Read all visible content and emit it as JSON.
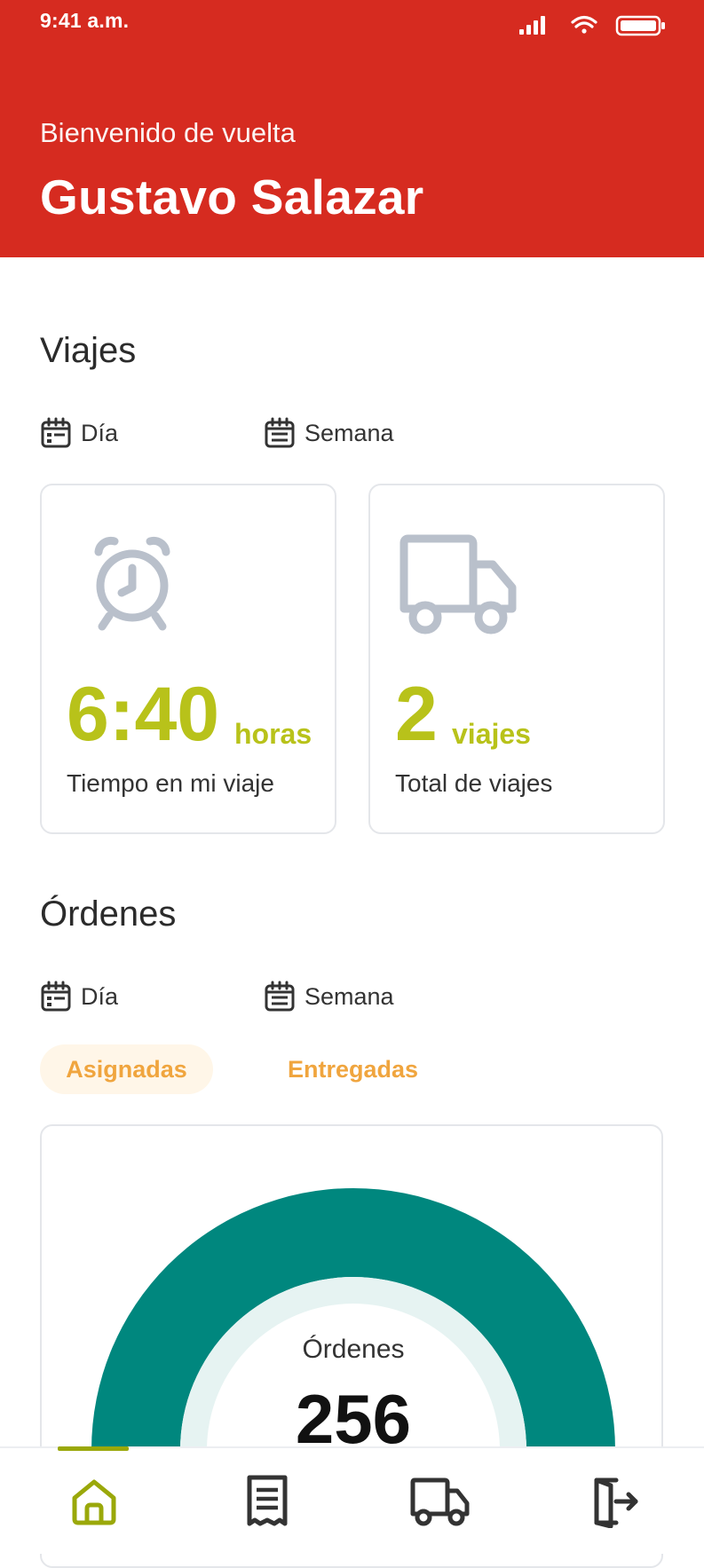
{
  "status_bar": {
    "time": "9:41 a.m."
  },
  "header": {
    "welcome": "Bienvenido de vuelta",
    "user_name": "Gustavo Salazar"
  },
  "viajes": {
    "title": "Viajes",
    "filters": [
      {
        "label": "Día",
        "icon": "calendar-icon"
      },
      {
        "label": "Semana",
        "icon": "calendar-list-icon"
      }
    ],
    "cards": [
      {
        "icon": "alarm-clock-icon",
        "value": "6:40",
        "unit": "horas",
        "caption": "Tiempo en mi viaje"
      },
      {
        "icon": "truck-icon",
        "value": "2",
        "unit": "viajes",
        "caption": "Total de viajes"
      }
    ]
  },
  "ordenes": {
    "title": "Órdenes",
    "filters": [
      {
        "label": "Día",
        "icon": "calendar-icon"
      },
      {
        "label": "Semana",
        "icon": "calendar-list-icon"
      }
    ],
    "tabs": [
      {
        "label": "Asignadas",
        "active": true
      },
      {
        "label": "Entregadas",
        "active": false
      }
    ],
    "gauge": {
      "label": "Órdenes",
      "value": "256"
    }
  },
  "bottom_nav": [
    {
      "name": "home",
      "icon": "home-icon",
      "active": true
    },
    {
      "name": "receipts",
      "icon": "receipt-icon",
      "active": false
    },
    {
      "name": "trips",
      "icon": "truck-icon",
      "active": false
    },
    {
      "name": "logout",
      "icon": "logout-icon",
      "active": false
    }
  ],
  "colors": {
    "header_red": "#d62b20",
    "accent_lime": "#b8c21a",
    "tab_orange": "#f0a53e",
    "gauge_teal": "#00877e",
    "gauge_track": "#e6f3f2",
    "icon_gray": "#b9c0cb",
    "nav_active": "#9aa80a"
  }
}
